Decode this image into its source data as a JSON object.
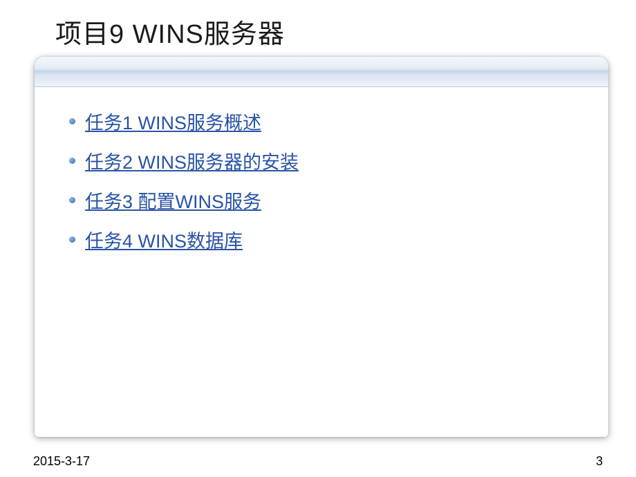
{
  "title": "项目9 WINS服务器",
  "tasks": [
    {
      "label": "任务1  WINS服务概述"
    },
    {
      "label": "任务2  WINS服务器的安装"
    },
    {
      "label": "任务3  配置WINS服务"
    },
    {
      "label": "任务4  WINS数据库"
    }
  ],
  "footer": {
    "date": "2015-3-17",
    "page": "3"
  }
}
